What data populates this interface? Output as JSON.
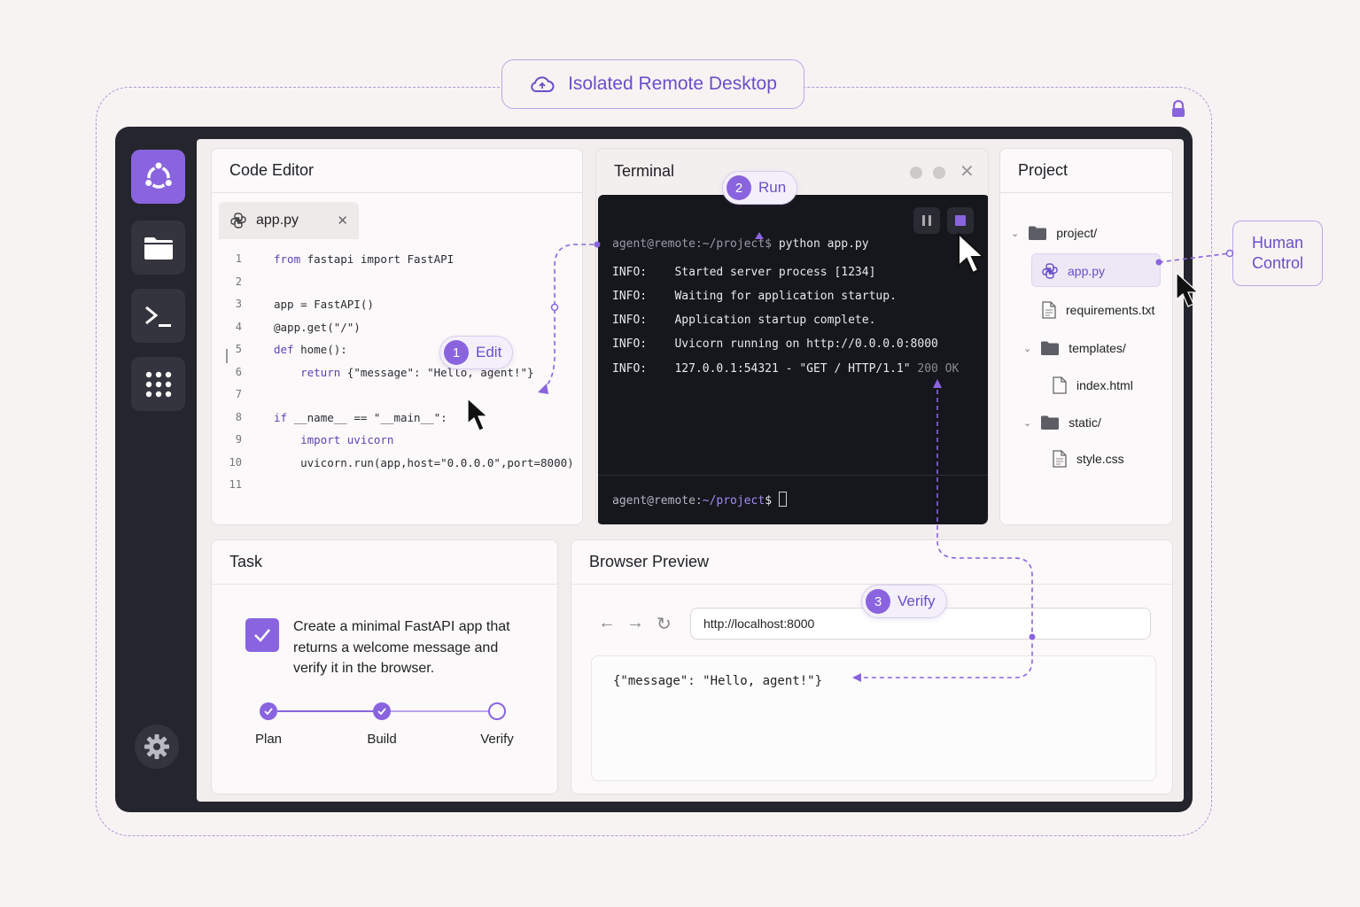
{
  "frame": {
    "label": "Isolated Remote Desktop"
  },
  "dock": {
    "items": [
      "ubuntu-logo",
      "folder",
      "terminal",
      "apps-grid"
    ],
    "settings": "gear"
  },
  "editor": {
    "title": "Code Editor",
    "tab": "app.py",
    "lines": [
      {
        "n": "1",
        "kw": "from",
        "rest": " fastapi import FastAPI"
      },
      {
        "n": "2",
        "kw": "",
        "rest": ""
      },
      {
        "n": "3",
        "kw": "",
        "rest": "app = FastAPI()"
      },
      {
        "n": "4",
        "kw": "",
        "rest": "@app.get(\"/\")"
      },
      {
        "n": "5",
        "kw": "def",
        "rest": " home():"
      },
      {
        "n": "6",
        "kw": "    return",
        "rest": " {\"message\": \"Hello, agent!\"}"
      },
      {
        "n": "7",
        "kw": "",
        "rest": ""
      },
      {
        "n": "8",
        "kw": "if",
        "rest": " __name__ == \"__main__\":"
      },
      {
        "n": "9",
        "kw": "    import uvicorn",
        "rest": ""
      },
      {
        "n": "10",
        "kw": "",
        "rest": "    uvicorn.run(app,host=\"0.0.0.0\",port=8000)"
      },
      {
        "n": "11",
        "kw": "",
        "rest": ""
      }
    ]
  },
  "terminal": {
    "title": "Terminal",
    "command_prompt": "agent@remote:~/project$",
    "command": " python app.py",
    "output": [
      "INFO:    Started server process [1234]",
      "INFO:    Waiting for application startup.",
      "INFO:    Application startup complete.",
      "INFO:    Uvicorn running on http://0.0.0.0:8000",
      "INFO:    127.0.0.1:54321 - \"GET / HTTP/1.1\""
    ],
    "status_code": " 200 OK",
    "prompt_user": "agent@remote:",
    "prompt_path": "~/project",
    "prompt_end": "$"
  },
  "project": {
    "title": "Project",
    "items": [
      "project/",
      "app.py",
      "requirements.txt",
      "templates/",
      "index.html",
      "static/",
      "style.css"
    ]
  },
  "task": {
    "title": "Task",
    "description": "Create a minimal FastAPI app that returns a welcome message and verify it in the browser.",
    "steps": [
      "Plan",
      "Build",
      "Verify"
    ]
  },
  "browser": {
    "title": "Browser Preview",
    "url": "http://localhost:8000",
    "response": "{\"message\": \"Hello, agent!\"}"
  },
  "callouts": {
    "edit": {
      "num": "1",
      "label": "Edit"
    },
    "run": {
      "num": "2",
      "label": "Run"
    },
    "verify": {
      "num": "3",
      "label": "Verify"
    },
    "human": "Human Control"
  },
  "colors": {
    "accent": "#8a64df",
    "dark": "#25252e",
    "terminal_bg": "#16161d"
  }
}
